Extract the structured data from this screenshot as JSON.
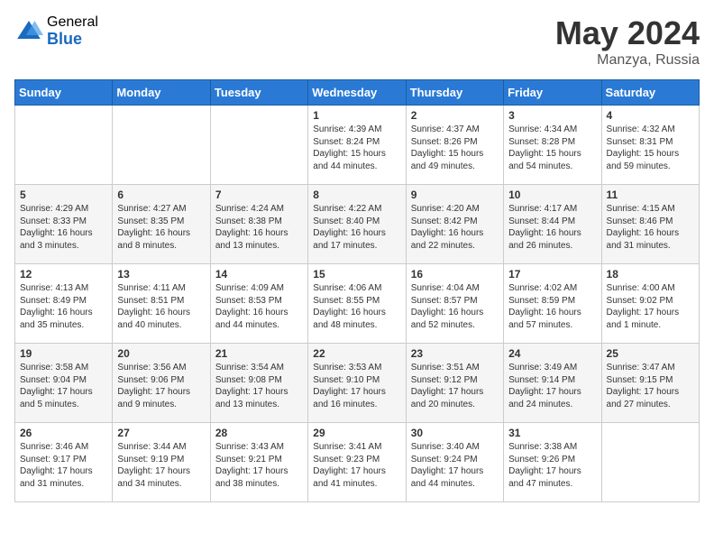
{
  "header": {
    "logo_general": "General",
    "logo_blue": "Blue",
    "title": "May 2024",
    "location": "Manzya, Russia"
  },
  "days_of_week": [
    "Sunday",
    "Monday",
    "Tuesday",
    "Wednesday",
    "Thursday",
    "Friday",
    "Saturday"
  ],
  "weeks": [
    [
      {
        "day": "",
        "info": ""
      },
      {
        "day": "",
        "info": ""
      },
      {
        "day": "",
        "info": ""
      },
      {
        "day": "1",
        "info": "Sunrise: 4:39 AM\nSunset: 8:24 PM\nDaylight: 15 hours\nand 44 minutes."
      },
      {
        "day": "2",
        "info": "Sunrise: 4:37 AM\nSunset: 8:26 PM\nDaylight: 15 hours\nand 49 minutes."
      },
      {
        "day": "3",
        "info": "Sunrise: 4:34 AM\nSunset: 8:28 PM\nDaylight: 15 hours\nand 54 minutes."
      },
      {
        "day": "4",
        "info": "Sunrise: 4:32 AM\nSunset: 8:31 PM\nDaylight: 15 hours\nand 59 minutes."
      }
    ],
    [
      {
        "day": "5",
        "info": "Sunrise: 4:29 AM\nSunset: 8:33 PM\nDaylight: 16 hours\nand 3 minutes."
      },
      {
        "day": "6",
        "info": "Sunrise: 4:27 AM\nSunset: 8:35 PM\nDaylight: 16 hours\nand 8 minutes."
      },
      {
        "day": "7",
        "info": "Sunrise: 4:24 AM\nSunset: 8:38 PM\nDaylight: 16 hours\nand 13 minutes."
      },
      {
        "day": "8",
        "info": "Sunrise: 4:22 AM\nSunset: 8:40 PM\nDaylight: 16 hours\nand 17 minutes."
      },
      {
        "day": "9",
        "info": "Sunrise: 4:20 AM\nSunset: 8:42 PM\nDaylight: 16 hours\nand 22 minutes."
      },
      {
        "day": "10",
        "info": "Sunrise: 4:17 AM\nSunset: 8:44 PM\nDaylight: 16 hours\nand 26 minutes."
      },
      {
        "day": "11",
        "info": "Sunrise: 4:15 AM\nSunset: 8:46 PM\nDaylight: 16 hours\nand 31 minutes."
      }
    ],
    [
      {
        "day": "12",
        "info": "Sunrise: 4:13 AM\nSunset: 8:49 PM\nDaylight: 16 hours\nand 35 minutes."
      },
      {
        "day": "13",
        "info": "Sunrise: 4:11 AM\nSunset: 8:51 PM\nDaylight: 16 hours\nand 40 minutes."
      },
      {
        "day": "14",
        "info": "Sunrise: 4:09 AM\nSunset: 8:53 PM\nDaylight: 16 hours\nand 44 minutes."
      },
      {
        "day": "15",
        "info": "Sunrise: 4:06 AM\nSunset: 8:55 PM\nDaylight: 16 hours\nand 48 minutes."
      },
      {
        "day": "16",
        "info": "Sunrise: 4:04 AM\nSunset: 8:57 PM\nDaylight: 16 hours\nand 52 minutes."
      },
      {
        "day": "17",
        "info": "Sunrise: 4:02 AM\nSunset: 8:59 PM\nDaylight: 16 hours\nand 57 minutes."
      },
      {
        "day": "18",
        "info": "Sunrise: 4:00 AM\nSunset: 9:02 PM\nDaylight: 17 hours\nand 1 minute."
      }
    ],
    [
      {
        "day": "19",
        "info": "Sunrise: 3:58 AM\nSunset: 9:04 PM\nDaylight: 17 hours\nand 5 minutes."
      },
      {
        "day": "20",
        "info": "Sunrise: 3:56 AM\nSunset: 9:06 PM\nDaylight: 17 hours\nand 9 minutes."
      },
      {
        "day": "21",
        "info": "Sunrise: 3:54 AM\nSunset: 9:08 PM\nDaylight: 17 hours\nand 13 minutes."
      },
      {
        "day": "22",
        "info": "Sunrise: 3:53 AM\nSunset: 9:10 PM\nDaylight: 17 hours\nand 16 minutes."
      },
      {
        "day": "23",
        "info": "Sunrise: 3:51 AM\nSunset: 9:12 PM\nDaylight: 17 hours\nand 20 minutes."
      },
      {
        "day": "24",
        "info": "Sunrise: 3:49 AM\nSunset: 9:14 PM\nDaylight: 17 hours\nand 24 minutes."
      },
      {
        "day": "25",
        "info": "Sunrise: 3:47 AM\nSunset: 9:15 PM\nDaylight: 17 hours\nand 27 minutes."
      }
    ],
    [
      {
        "day": "26",
        "info": "Sunrise: 3:46 AM\nSunset: 9:17 PM\nDaylight: 17 hours\nand 31 minutes."
      },
      {
        "day": "27",
        "info": "Sunrise: 3:44 AM\nSunset: 9:19 PM\nDaylight: 17 hours\nand 34 minutes."
      },
      {
        "day": "28",
        "info": "Sunrise: 3:43 AM\nSunset: 9:21 PM\nDaylight: 17 hours\nand 38 minutes."
      },
      {
        "day": "29",
        "info": "Sunrise: 3:41 AM\nSunset: 9:23 PM\nDaylight: 17 hours\nand 41 minutes."
      },
      {
        "day": "30",
        "info": "Sunrise: 3:40 AM\nSunset: 9:24 PM\nDaylight: 17 hours\nand 44 minutes."
      },
      {
        "day": "31",
        "info": "Sunrise: 3:38 AM\nSunset: 9:26 PM\nDaylight: 17 hours\nand 47 minutes."
      },
      {
        "day": "",
        "info": ""
      }
    ]
  ]
}
